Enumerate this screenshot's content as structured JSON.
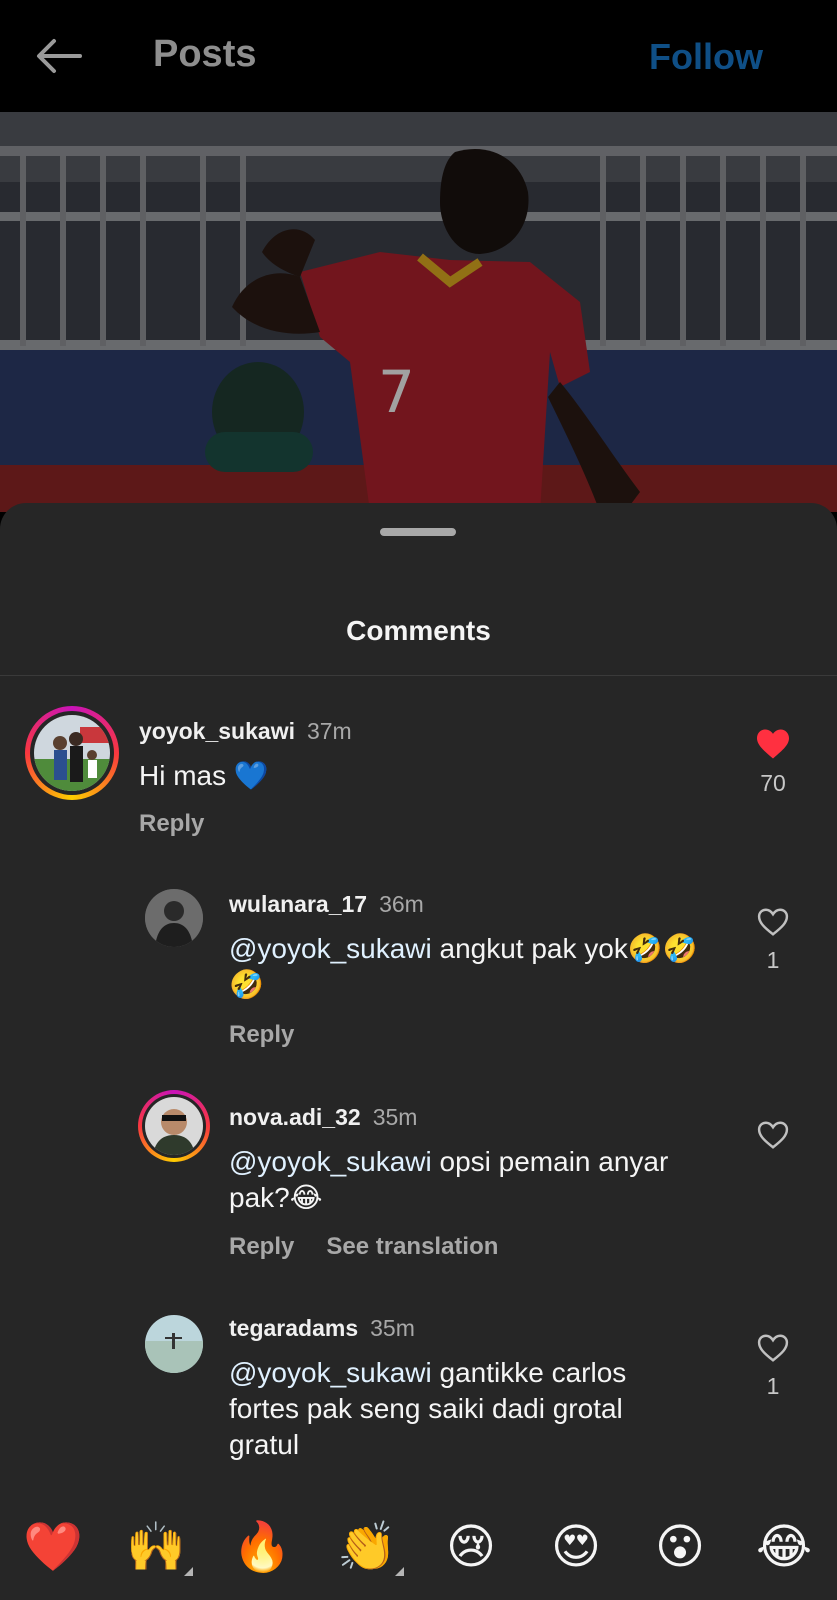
{
  "header": {
    "title": "Posts",
    "follow_label": "Follow"
  },
  "sheet": {
    "title": "Comments"
  },
  "comments": [
    {
      "user": "yoyok_sukawi",
      "time": "37m",
      "mention": "",
      "body": "Hi mas 💙",
      "likes": "70",
      "liked": true,
      "actions": [
        "Reply"
      ]
    },
    {
      "user": "wulanara_17",
      "time": "36m",
      "mention": "@yoyok_sukawi",
      "body": " angkut pak yok🤣🤣🤣",
      "likes": "1",
      "liked": false,
      "actions": [
        "Reply"
      ]
    },
    {
      "user": "nova.adi_32",
      "time": "35m",
      "mention": "@yoyok_sukawi",
      "body": " opsi pemain anyar pak?😂",
      "likes": "",
      "liked": false,
      "actions": [
        "Reply",
        "See translation"
      ]
    },
    {
      "user": "tegaradams",
      "time": "35m",
      "mention": "@yoyok_sukawi",
      "body": " gantikke carlos fortes pak seng saiki dadi grotal gratul",
      "likes": "1",
      "liked": false,
      "actions": []
    }
  ],
  "emoji_bar": [
    "❤️",
    "🙌",
    "🔥",
    "👏",
    "😢",
    "😍",
    "😮",
    "😂"
  ],
  "icons": {
    "back": "arrow-left-icon",
    "heart_filled": "heart-filled-icon",
    "heart_outline": "heart-outline-icon"
  },
  "colors": {
    "follow": "#0f4f86",
    "like": "#ff3040",
    "background": "#262626"
  }
}
